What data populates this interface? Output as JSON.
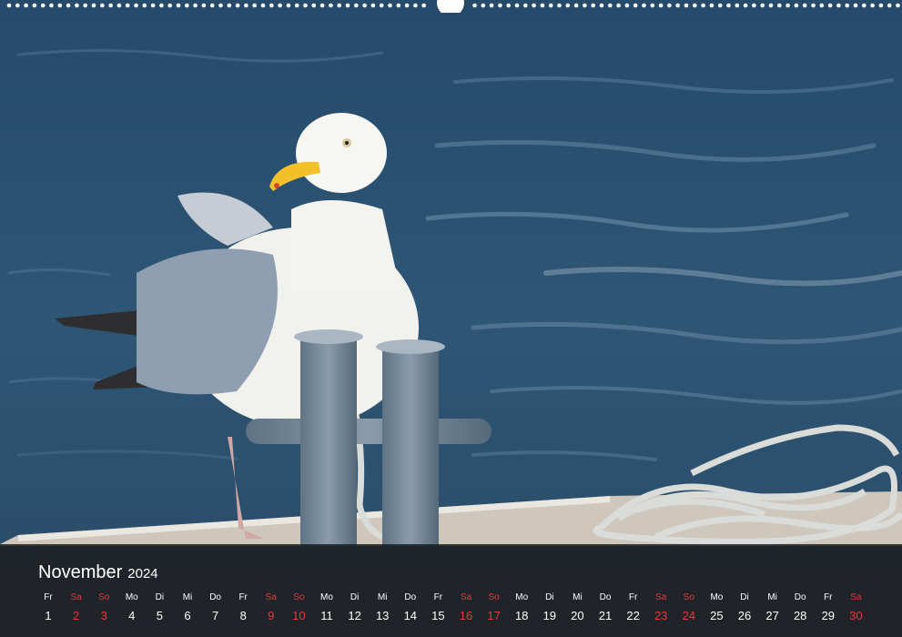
{
  "calendar": {
    "month": "November",
    "year": "2024",
    "weekend_color": "#e03a3a",
    "days": [
      {
        "name": "Fr",
        "num": "1",
        "weekend": false
      },
      {
        "name": "Sa",
        "num": "2",
        "weekend": true
      },
      {
        "name": "So",
        "num": "3",
        "weekend": true
      },
      {
        "name": "Mo",
        "num": "4",
        "weekend": false
      },
      {
        "name": "Di",
        "num": "5",
        "weekend": false
      },
      {
        "name": "Mi",
        "num": "6",
        "weekend": false
      },
      {
        "name": "Do",
        "num": "7",
        "weekend": false
      },
      {
        "name": "Fr",
        "num": "8",
        "weekend": false
      },
      {
        "name": "Sa",
        "num": "9",
        "weekend": true
      },
      {
        "name": "So",
        "num": "10",
        "weekend": true
      },
      {
        "name": "Mo",
        "num": "11",
        "weekend": false
      },
      {
        "name": "Di",
        "num": "12",
        "weekend": false
      },
      {
        "name": "Mi",
        "num": "13",
        "weekend": false
      },
      {
        "name": "Do",
        "num": "14",
        "weekend": false
      },
      {
        "name": "Fr",
        "num": "15",
        "weekend": false
      },
      {
        "name": "Sa",
        "num": "16",
        "weekend": true
      },
      {
        "name": "So",
        "num": "17",
        "weekend": true
      },
      {
        "name": "Mo",
        "num": "18",
        "weekend": false
      },
      {
        "name": "Di",
        "num": "19",
        "weekend": false
      },
      {
        "name": "Mi",
        "num": "20",
        "weekend": false
      },
      {
        "name": "Do",
        "num": "21",
        "weekend": false
      },
      {
        "name": "Fr",
        "num": "22",
        "weekend": false
      },
      {
        "name": "Sa",
        "num": "23",
        "weekend": true
      },
      {
        "name": "So",
        "num": "24",
        "weekend": true
      },
      {
        "name": "Mo",
        "num": "25",
        "weekend": false
      },
      {
        "name": "Di",
        "num": "26",
        "weekend": false
      },
      {
        "name": "Mi",
        "num": "27",
        "weekend": false
      },
      {
        "name": "Do",
        "num": "28",
        "weekend": false
      },
      {
        "name": "Fr",
        "num": "29",
        "weekend": false
      },
      {
        "name": "Sa",
        "num": "30",
        "weekend": true
      }
    ]
  }
}
